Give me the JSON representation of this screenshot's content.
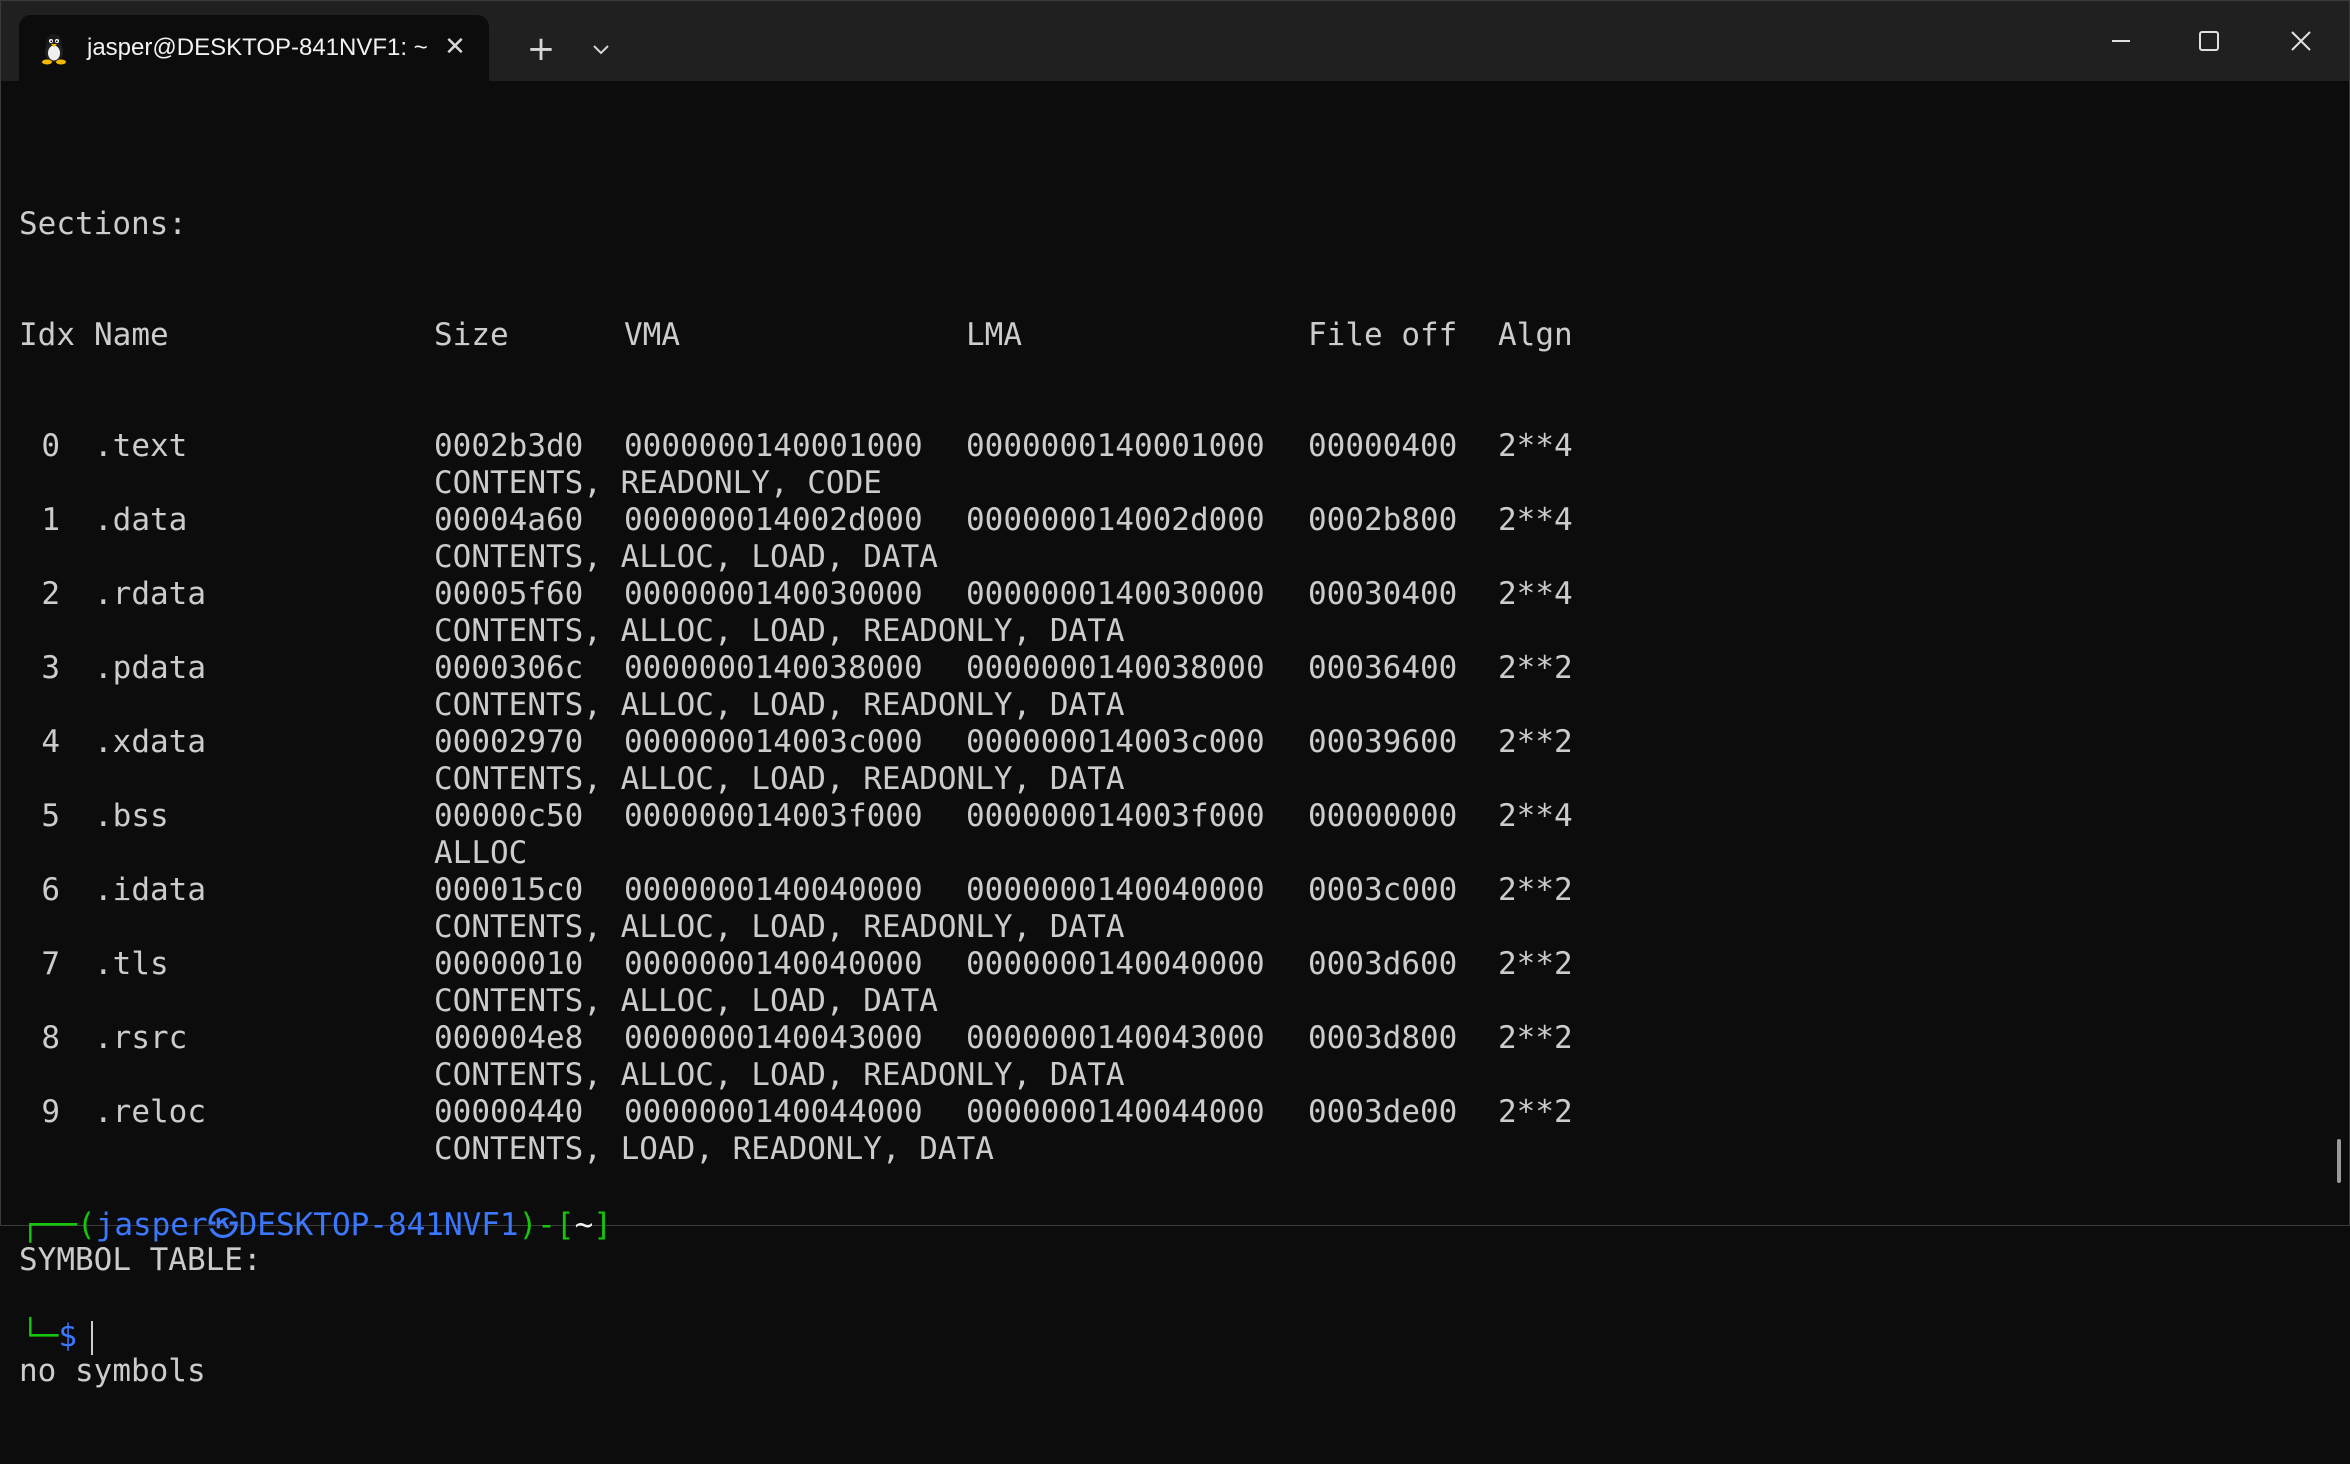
{
  "window": {
    "tab_title": "jasper@DESKTOP-841NVF1: ~",
    "tab_icon": "linux-tux-icon",
    "new_tab_label": "+",
    "close_tab_label": "✕"
  },
  "terminal": {
    "sections_header": "Sections:",
    "columns": {
      "idx": "Idx",
      "name": "Name",
      "size": "Size",
      "vma": "VMA",
      "lma": "LMA",
      "file_off": "File off",
      "algn": "Algn"
    },
    "sections": [
      {
        "idx": "0",
        "name": ".text",
        "size": "0002b3d0",
        "vma": "0000000140001000",
        "lma": "0000000140001000",
        "file_off": "00000400",
        "algn": "2**4",
        "flags": "CONTENTS, READONLY, CODE"
      },
      {
        "idx": "1",
        "name": ".data",
        "size": "00004a60",
        "vma": "000000014002d000",
        "lma": "000000014002d000",
        "file_off": "0002b800",
        "algn": "2**4",
        "flags": "CONTENTS, ALLOC, LOAD, DATA"
      },
      {
        "idx": "2",
        "name": ".rdata",
        "size": "00005f60",
        "vma": "0000000140030000",
        "lma": "0000000140030000",
        "file_off": "00030400",
        "algn": "2**4",
        "flags": "CONTENTS, ALLOC, LOAD, READONLY, DATA"
      },
      {
        "idx": "3",
        "name": ".pdata",
        "size": "0000306c",
        "vma": "0000000140038000",
        "lma": "0000000140038000",
        "file_off": "00036400",
        "algn": "2**2",
        "flags": "CONTENTS, ALLOC, LOAD, READONLY, DATA"
      },
      {
        "idx": "4",
        "name": ".xdata",
        "size": "00002970",
        "vma": "000000014003c000",
        "lma": "000000014003c000",
        "file_off": "00039600",
        "algn": "2**2",
        "flags": "CONTENTS, ALLOC, LOAD, READONLY, DATA"
      },
      {
        "idx": "5",
        "name": ".bss",
        "size": "00000c50",
        "vma": "000000014003f000",
        "lma": "000000014003f000",
        "file_off": "00000000",
        "algn": "2**4",
        "flags": "ALLOC"
      },
      {
        "idx": "6",
        "name": ".idata",
        "size": "000015c0",
        "vma": "0000000140040000",
        "lma": "0000000140040000",
        "file_off": "0003c000",
        "algn": "2**2",
        "flags": "CONTENTS, ALLOC, LOAD, READONLY, DATA"
      },
      {
        "idx": "7",
        "name": ".tls",
        "size": "00000010",
        "vma": "0000000140040000",
        "lma": "0000000140040000",
        "file_off": "0003d600",
        "algn": "2**2",
        "flags": "CONTENTS, ALLOC, LOAD, DATA"
      },
      {
        "idx": "8",
        "name": ".rsrc",
        "size": "000004e8",
        "vma": "0000000140043000",
        "lma": "0000000140043000",
        "file_off": "0003d800",
        "algn": "2**2",
        "flags": "CONTENTS, ALLOC, LOAD, READONLY, DATA"
      },
      {
        "idx": "9",
        "name": ".reloc",
        "size": "00000440",
        "vma": "0000000140044000",
        "lma": "0000000140044000",
        "file_off": "0003de00",
        "algn": "2**2",
        "flags": "CONTENTS, LOAD, READONLY, DATA"
      }
    ],
    "symbol_table_header": "SYMBOL TABLE:",
    "symbol_table_value": "no symbols"
  },
  "prompt": {
    "corner_top": "┌──(",
    "user": "jasper",
    "separator_glyph": "㉿",
    "host": "DESKTOP-841NVF1",
    "mid": ")-[",
    "cwd": "~",
    "end": "]",
    "corner_bottom": "└─",
    "symbol": "$"
  },
  "colors": {
    "background": "#0c0c0c",
    "text": "#cccccc",
    "prompt_green": "#16c60c",
    "prompt_blue": "#3b78ff",
    "titlebar": "#202020"
  }
}
